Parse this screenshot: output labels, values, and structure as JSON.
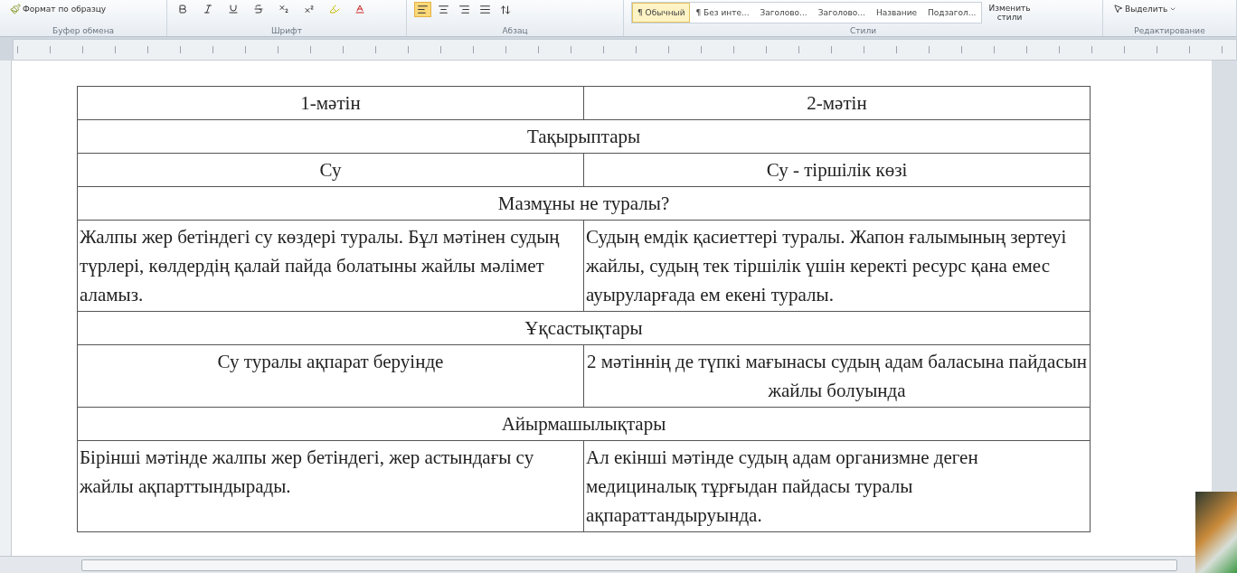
{
  "ribbon": {
    "clipboard": {
      "format_painter": "Формат по образцу",
      "label": "Буфер обмена"
    },
    "font": {
      "label": "Шрифт"
    },
    "paragraph": {
      "label": "Абзац",
      "align": [
        {
          "kind": "left",
          "selected": true
        },
        {
          "kind": "center",
          "selected": false
        },
        {
          "kind": "right",
          "selected": false
        },
        {
          "kind": "justify",
          "selected": false
        }
      ]
    },
    "styles": {
      "label": "Стили",
      "items": [
        {
          "label": "¶ Обычный",
          "selected": true
        },
        {
          "label": "¶ Без инте...",
          "selected": false
        },
        {
          "label": "Заголово...",
          "selected": false
        },
        {
          "label": "Заголово...",
          "selected": false
        },
        {
          "label": "Название",
          "selected": false
        },
        {
          "label": "Подзагол...",
          "selected": false
        }
      ],
      "change": "Изменить стили"
    },
    "editing": {
      "label": "Редактирование",
      "select": "Выделить"
    }
  },
  "table": {
    "rows": [
      {
        "kind": "centered",
        "cells": [
          {
            "text": "1-мәтін"
          },
          {
            "text": "2-мәтін"
          }
        ]
      },
      {
        "kind": "span",
        "cells": [
          {
            "text": "Тақырыптары",
            "colspan": 2
          }
        ]
      },
      {
        "kind": "centered",
        "cells": [
          {
            "text": "Су"
          },
          {
            "text": "Су - тіршілік көзі"
          }
        ]
      },
      {
        "kind": "span",
        "cells": [
          {
            "text": "Мазмұны не туралы?",
            "colspan": 2
          }
        ]
      },
      {
        "kind": "text",
        "cells": [
          {
            "text": "Жалпы жер бетіндегі су көздері туралы. Бұл мәтінен судың түрлері, көлдердің қалай пайда болатыны жайлы мәлімет аламыз."
          },
          {
            "text": "Судың емдік қасиеттері туралы. Жапон ғалымының зертеуі жайлы, судың тек тіршілік үшін керекті ресурс қана емес ауыруларғада ем екені туралы."
          }
        ]
      },
      {
        "kind": "span",
        "cells": [
          {
            "text": "Ұқсастықтары",
            "colspan": 2
          }
        ]
      },
      {
        "kind": "centered",
        "cells": [
          {
            "text": "Су туралы ақпарат беруінде"
          },
          {
            "text": "2 мәтіннің де түпкі мағынасы судың адам баласына пайдасын жайлы болуында"
          }
        ]
      },
      {
        "kind": "span",
        "cells": [
          {
            "text": "Айырмашылықтары",
            "colspan": 2
          }
        ]
      },
      {
        "kind": "text",
        "cells": [
          {
            "text": "Бірінші мәтінде жалпы жер бетіндегі, жер астындағы су жайлы ақпарттындырады."
          },
          {
            "text": "Ал екінші мәтінде судың адам организмне деген медициналық тұрғыдан пайдасы туралы ақпараттандыруында."
          }
        ]
      }
    ]
  }
}
